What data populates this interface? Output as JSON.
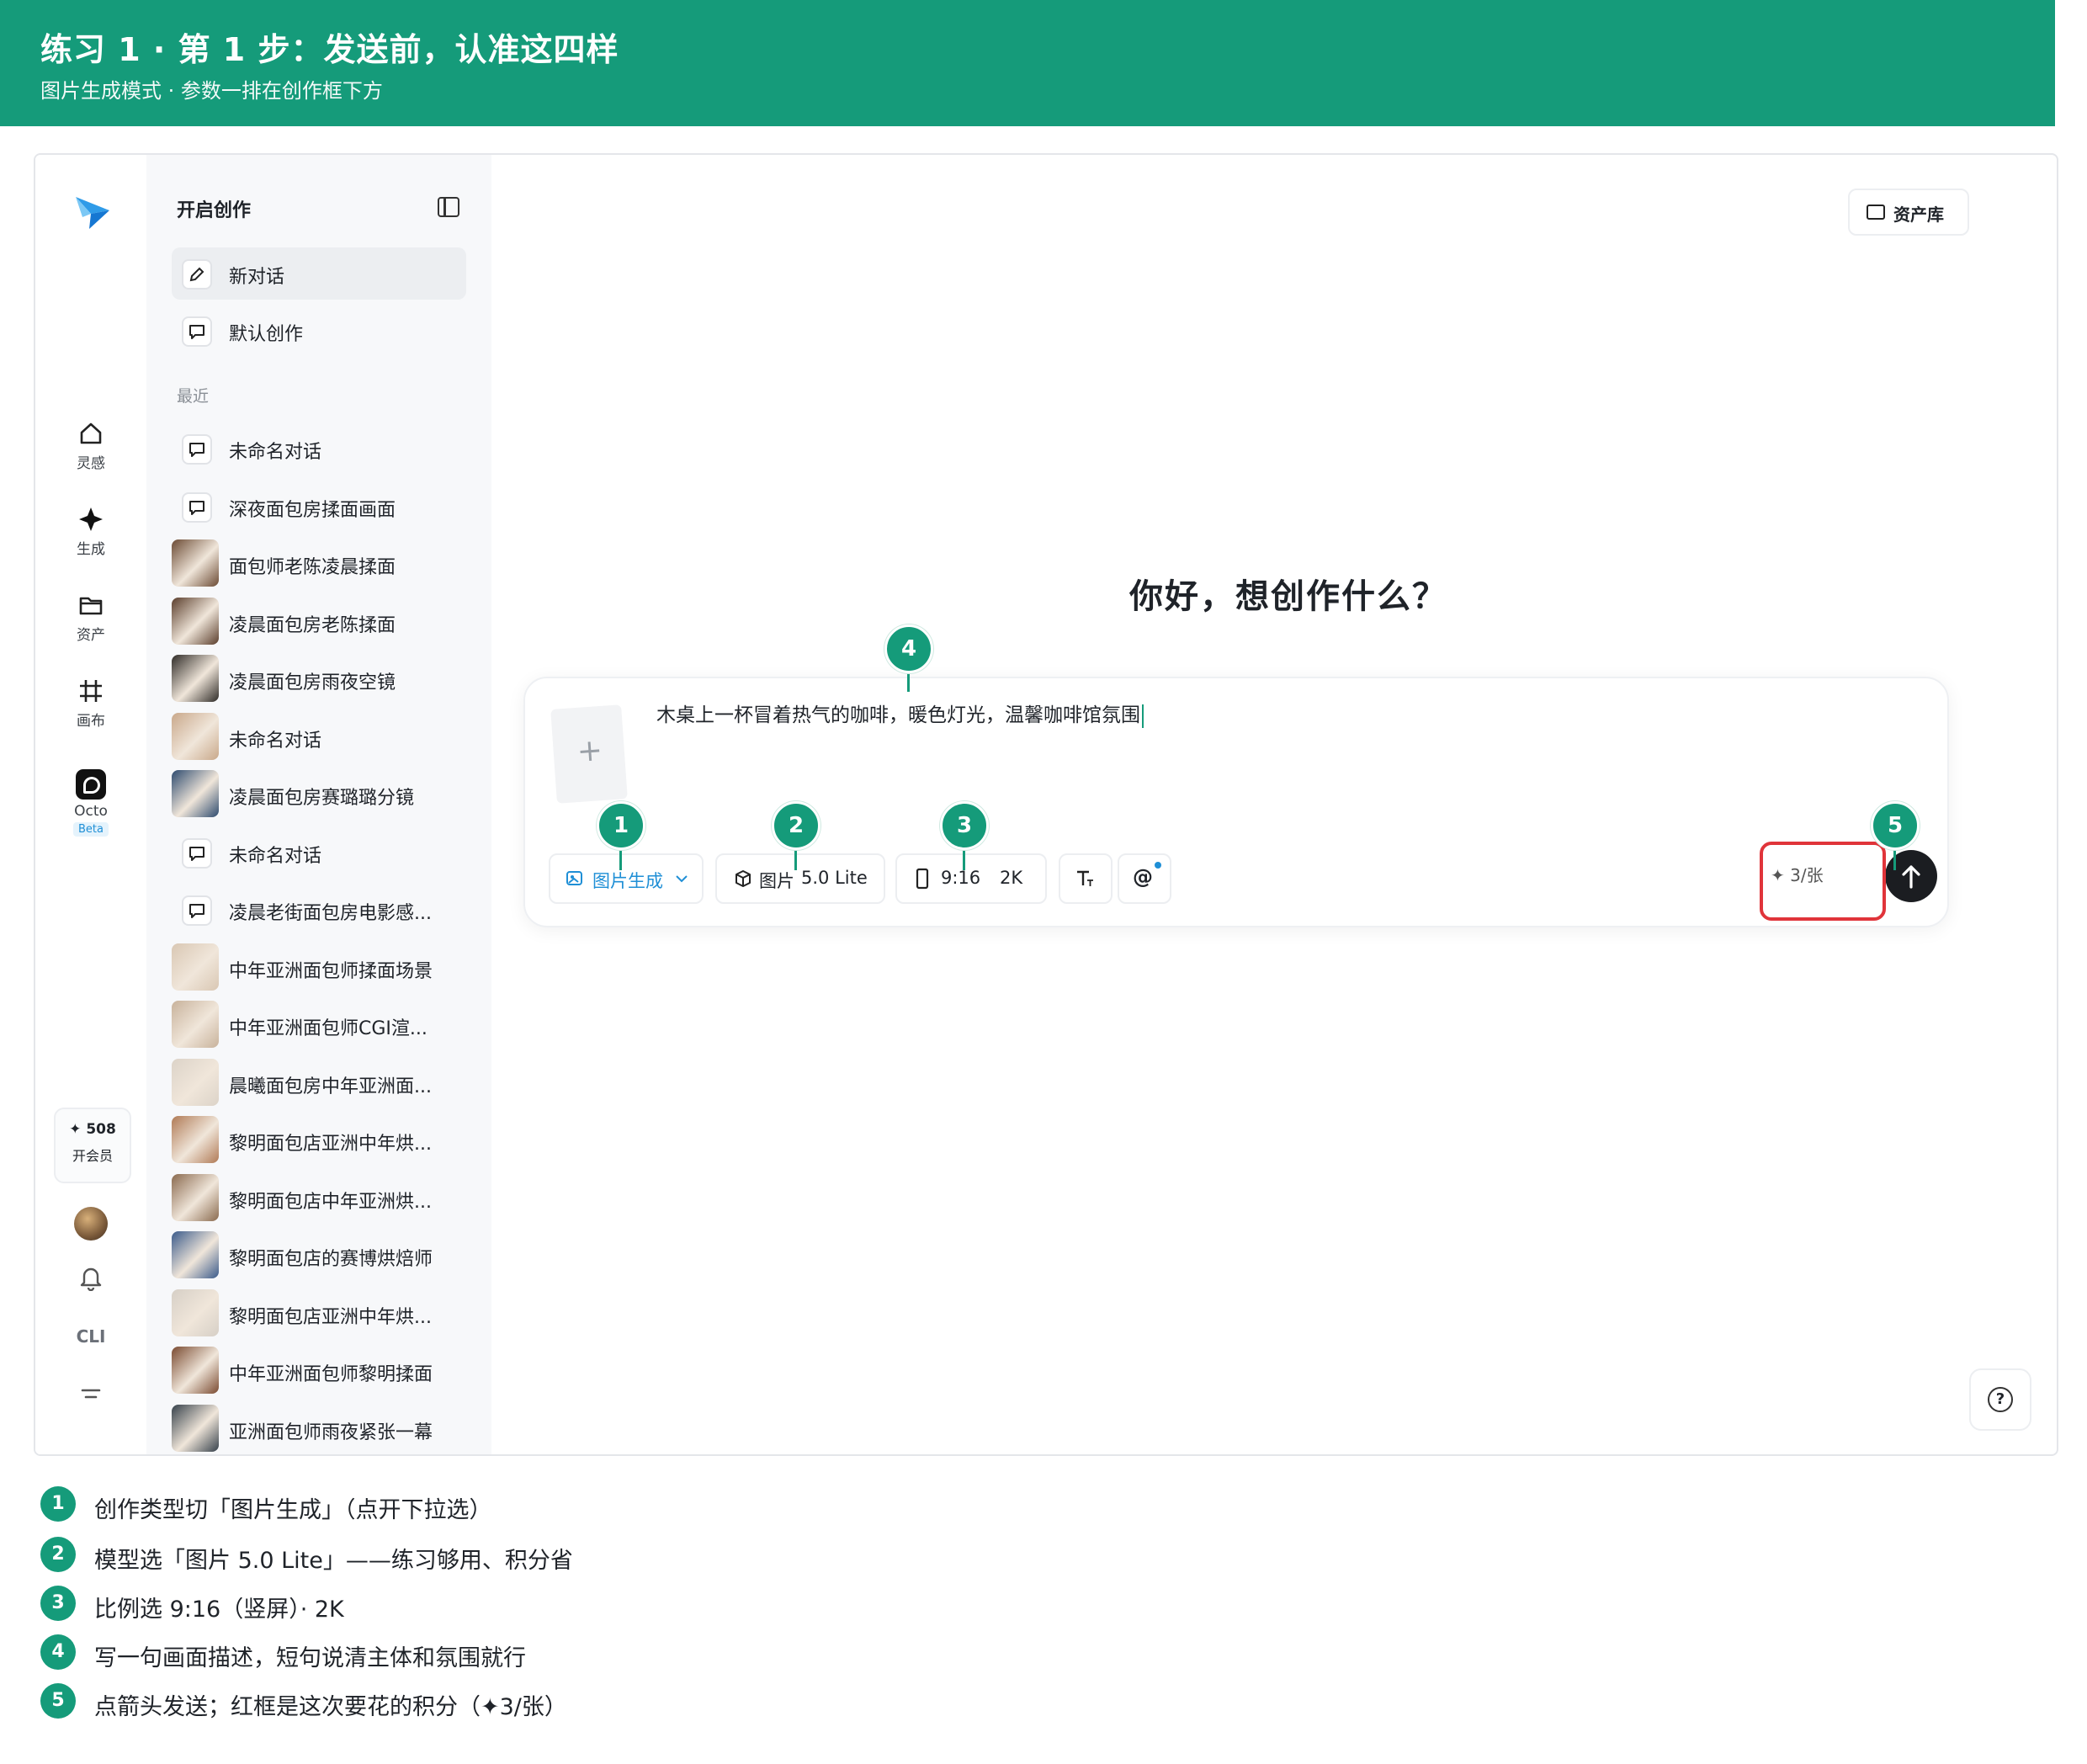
{
  "banner": {
    "title": "练习 1 · 第 1 步：发送前，认准这四样",
    "subtitle": "图片生成模式 · 参数一排在创作框下方"
  },
  "rail": {
    "items": [
      {
        "label": "灵感",
        "icon": "home-icon"
      },
      {
        "label": "生成",
        "icon": "sparkle-icon"
      },
      {
        "label": "资产",
        "icon": "folder-icon"
      },
      {
        "label": "画布",
        "icon": "canvas-grid-icon"
      },
      {
        "label": "Octo",
        "icon": "octo-icon",
        "badge": "Beta"
      }
    ],
    "member": {
      "points": "✦ 508",
      "label": "开会员"
    },
    "cli": "CLI"
  },
  "sidebar": {
    "header": "开启创作",
    "actions": [
      {
        "label": "新对话",
        "icon": "edit-icon"
      },
      {
        "label": "默认创作",
        "icon": "chat-bubble-icon"
      }
    ],
    "recent_label": "最近",
    "recent": [
      {
        "label": "未命名对话",
        "thumb": false
      },
      {
        "label": "深夜面包房揉面画面",
        "thumb": false
      },
      {
        "label": "面包师老陈凌晨揉面",
        "thumb": true,
        "color": "#6b4a33"
      },
      {
        "label": "凌晨面包房老陈揉面",
        "thumb": true,
        "color": "#5a3d2b"
      },
      {
        "label": "凌晨面包房雨夜空镜",
        "thumb": true,
        "color": "#2e2a26"
      },
      {
        "label": "未命名对话",
        "thumb": true,
        "color": "#c9a88a"
      },
      {
        "label": "凌晨面包房赛璐璐分镜",
        "thumb": true,
        "color": "#2d4a6e"
      },
      {
        "label": "未命名对话",
        "thumb": false
      },
      {
        "label": "凌晨老街面包房电影感...",
        "thumb": false
      },
      {
        "label": "中年亚洲面包师揉面场景",
        "thumb": true,
        "color": "#d9c7b3"
      },
      {
        "label": "中年亚洲面包师CGI渲...",
        "thumb": true,
        "color": "#c8b29b"
      },
      {
        "label": "晨曦面包房中年亚洲面...",
        "thumb": true,
        "color": "#dcd3c8"
      },
      {
        "label": "黎明面包店亚洲中年烘...",
        "thumb": true,
        "color": "#b07a55"
      },
      {
        "label": "黎明面包店中年亚洲烘...",
        "thumb": true,
        "color": "#8a6a4e"
      },
      {
        "label": "黎明面包店的赛博烘焙师",
        "thumb": true,
        "color": "#3a5a8a"
      },
      {
        "label": "黎明面包店亚洲中年烘...",
        "thumb": true,
        "color": "#d6cfc6"
      },
      {
        "label": "中年亚洲面包师黎明揉面",
        "thumb": true,
        "color": "#7a4a30"
      },
      {
        "label": "亚洲面包师雨夜紧张一幕",
        "thumb": true,
        "color": "#35404a"
      }
    ]
  },
  "main": {
    "asset_library": "资产库",
    "greeting": "你好，想创作什么？",
    "prompt": "木桌上一杯冒着热气的咖啡，暖色灯光，温馨咖啡馆氛围",
    "chips": {
      "type": "图片生成",
      "model_a": "图片",
      "model_b": "5.0 Lite",
      "ratio": "9:16",
      "resolution": "2K"
    },
    "cost": "✦ 3/张"
  },
  "markers": [
    "1",
    "2",
    "3",
    "4",
    "5"
  ],
  "legend": [
    {
      "n": "1",
      "text": "创作类型切「图片生成」（点开下拉选）"
    },
    {
      "n": "2",
      "text": "模型选「图片 5.0 Lite」——练习够用、积分省"
    },
    {
      "n": "3",
      "text": "比例选 9:16（竖屏）· 2K"
    },
    {
      "n": "4",
      "text": "写一句画面描述，短句说清主体和氛围就行"
    },
    {
      "n": "5",
      "text": "点箭头发送；红框是这次要花的积分（✦3/张）"
    }
  ],
  "colors": {
    "accent": "#159b7a",
    "highlight": "#e0343a",
    "link": "#1f8fd6"
  }
}
